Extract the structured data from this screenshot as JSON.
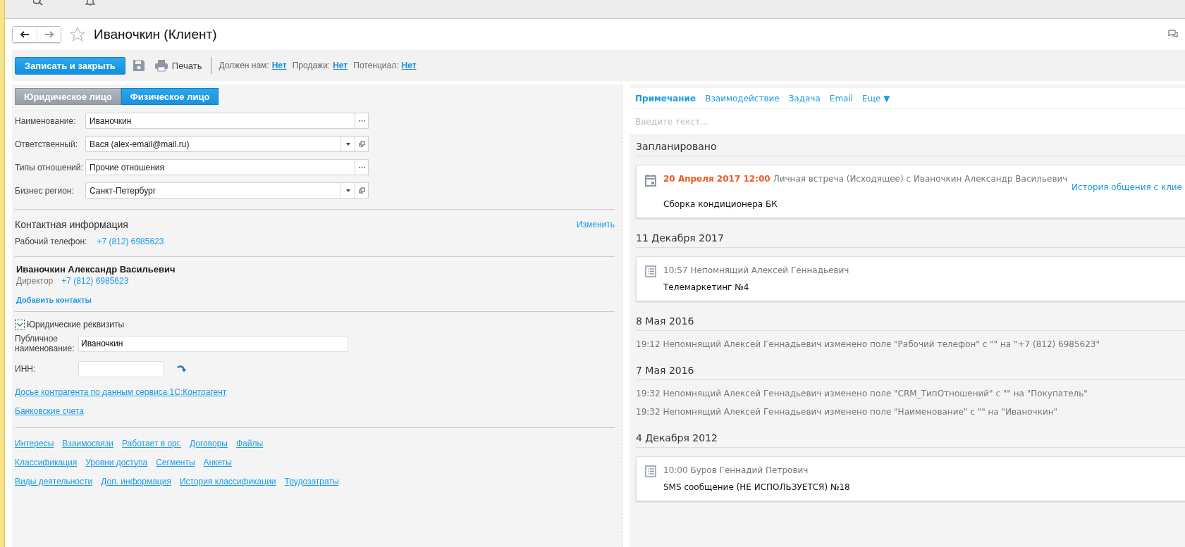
{
  "header": {
    "title": "Иваночкин (Клиент)",
    "favorite": false
  },
  "toolbar": {
    "save_close": "Записать и закрыть",
    "print": "Печать",
    "stats": [
      {
        "label": "Должен нам:",
        "value": "Нет"
      },
      {
        "label": "Продажи:",
        "value": "Нет"
      },
      {
        "label": "Потенциал:",
        "value": "Нет"
      }
    ]
  },
  "entity_tabs": [
    {
      "label": "Юридическое лицо",
      "selected": false
    },
    {
      "label": "Физическое лицо",
      "selected": true
    }
  ],
  "fields": [
    {
      "label": "Наименование:",
      "value": "Иваночкин",
      "kind": "choice"
    },
    {
      "label": "Ответственный:",
      "value": "Вася (alex-email@mail.ru)",
      "kind": "select"
    },
    {
      "label": "Типы отношений:",
      "value": "Прочие отношения",
      "kind": "choice"
    },
    {
      "label": "Бизнес регион:",
      "value": "Санкт-Петербург",
      "kind": "select"
    }
  ],
  "contact_info": {
    "title": "Контактная информация",
    "edit": "Изменить",
    "phones": [
      {
        "label": "Рабочий телефон:",
        "value": "+7 (812) 6985623"
      }
    ]
  },
  "contact_person": {
    "name": "Иваночкин Александр Васильевич",
    "role": "Директор",
    "phone": "+7 (812) 6985623",
    "add": "Добавить контакты"
  },
  "legal": {
    "title": "Юридические реквизиты",
    "expanded": true,
    "public_name_label": "Публичное наименование:",
    "public_name": "Иваночкин",
    "inn_label": "ИНН:",
    "links": [
      "Досье контрагента по данным сервиса 1С:Контрагент",
      "Банковские счета"
    ]
  },
  "link_rows": [
    [
      "Интересы",
      "Взаимосвязи",
      "Работает в орг.",
      "Договоры",
      "Файлы"
    ],
    [
      "Классификация",
      "Уровни доступа",
      "Сегменты",
      "Анкеты"
    ],
    [
      "Виды деятельности",
      "Доп. информация",
      "История классификации",
      "Трудозатраты"
    ]
  ],
  "feed_tabs": [
    {
      "label": "Примечание",
      "selected": true
    },
    {
      "label": "Взаимодействие",
      "selected": false
    },
    {
      "label": "Задача",
      "selected": false
    },
    {
      "label": "Email",
      "selected": false
    },
    {
      "label": "Еще ▼",
      "selected": false
    }
  ],
  "feed_input": {
    "placeholder": "Введите текст..."
  },
  "groups": [
    {
      "title": "Запланировано",
      "entries": [
        {
          "kind": "meeting",
          "when": "20 Апреля 2017 12:00",
          "text": "Личная встреча (Исходящее) с Иваночкин Александр Васильевич",
          "link": "История общения с клие",
          "body": "Сборка кондиционера БК"
        }
      ]
    },
    {
      "title": "11 Декабря 2017",
      "entries": [
        {
          "kind": "note",
          "text": "10:57 Непомнящий Алексей Геннадьевич",
          "body": "Телемаркетинг №4"
        }
      ]
    },
    {
      "title": "8 Мая 2016",
      "entries": [
        {
          "kind": "change",
          "text": "19:12 Непомнящий Алексей Геннадьевич изменено поле \"Рабочий телефон\" с \"\" на \"+7 (812) 6985623\""
        }
      ]
    },
    {
      "title": "7 Мая 2016",
      "entries": [
        {
          "kind": "change",
          "text": "19:32 Непомнящий Алексей Геннадьевич изменено поле \"CRM_ТипОтношений\" с \"\" на \"Покупатель\""
        },
        {
          "kind": "change",
          "text": "19:32 Непомнящий Алексей Геннадьевич изменено поле \"Наименование\" с \"\" на \"Иваночкин\""
        }
      ]
    },
    {
      "title": "4 Декабря 2012",
      "entries": [
        {
          "kind": "note",
          "text": "10:00 Буров Геннадий Петрович",
          "body": "SMS сообщение (НЕ ИСПОЛЬЗУЕТСЯ) №18"
        }
      ]
    }
  ]
}
